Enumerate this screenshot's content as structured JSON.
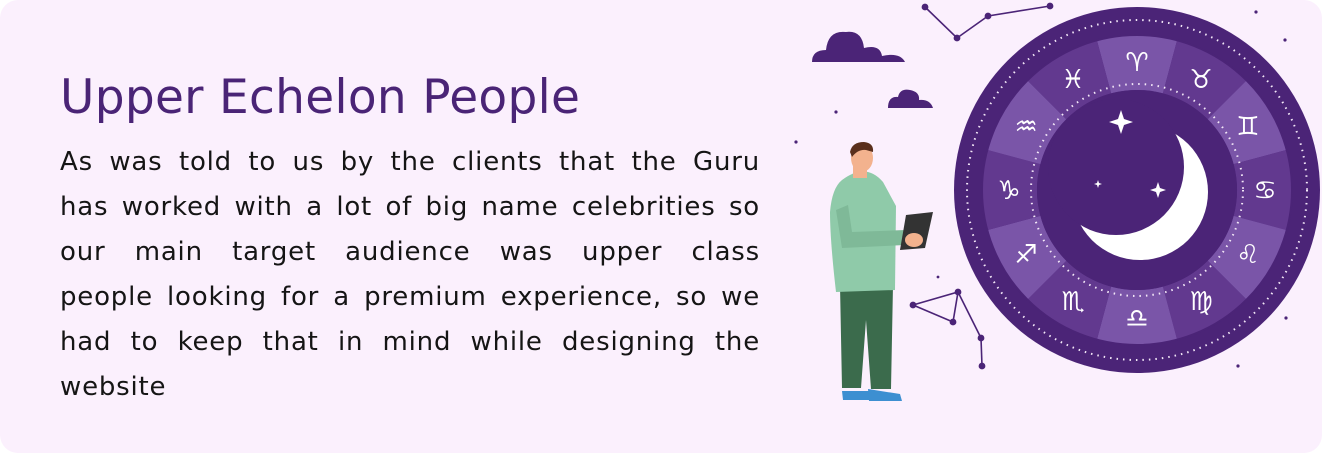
{
  "card": {
    "heading": "Upper Echelon People",
    "description": "As was told to us by the clients that the Guru has worked with a lot of big name celebrities so our main target audience was upper class people looking for a premium experience, so we had to keep that in mind while designing the website"
  },
  "illustration": {
    "zodiac_signs": [
      "aries",
      "taurus",
      "gemini",
      "cancer",
      "leo",
      "virgo",
      "libra",
      "scorpio",
      "sagittarius",
      "capricorn",
      "aquarius",
      "pisces"
    ],
    "zodiac_glyphs": [
      "♈︎",
      "♉︎",
      "♊︎",
      "♋︎",
      "♌︎",
      "♍︎",
      "♎︎",
      "♏︎",
      "♐︎",
      "♑︎",
      "♒︎",
      "♓︎"
    ],
    "colors": {
      "background": "#fbf0fd",
      "heading": "#4a2476",
      "wheel_dark": "#4b2477",
      "wheel_mid": "#62398f",
      "wheel_light": "#7a55a8",
      "moon": "#ffffff",
      "hoodie": "#8fcaa9",
      "pants": "#3b6b4c",
      "skin": "#f3b28e",
      "hair": "#5a2f1c",
      "shoes": "#3d8fd1"
    }
  }
}
